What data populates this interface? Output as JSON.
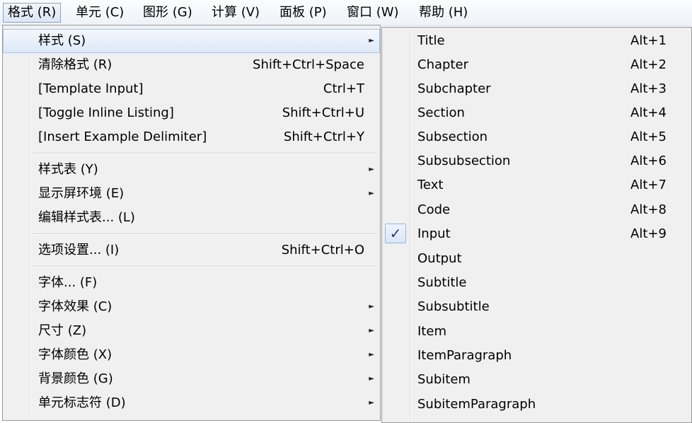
{
  "menubar": [
    {
      "label": "格式 (R)",
      "active": true
    },
    {
      "label": "单元 (C)"
    },
    {
      "label": "图形 (G)"
    },
    {
      "label": "计算 (V)"
    },
    {
      "label": "面板 (P)"
    },
    {
      "label": "窗口 (W)"
    },
    {
      "label": "帮助 (H)"
    }
  ],
  "format_menu": {
    "items": [
      {
        "label": "样式 (S)",
        "shortcut": "",
        "submenu": true,
        "highlighted": true
      },
      {
        "label": "清除格式 (R)",
        "shortcut": "Shift+Ctrl+Space"
      },
      {
        "label": "[Template Input]",
        "shortcut": "Ctrl+T"
      },
      {
        "label": "[Toggle Inline Listing]",
        "shortcut": "Shift+Ctrl+U"
      },
      {
        "label": "[Insert Example Delimiter]",
        "shortcut": "Shift+Ctrl+Y"
      },
      {
        "label": "样式表 (Y)",
        "shortcut": "",
        "submenu": true
      },
      {
        "label": "显示屏环境 (E)",
        "shortcut": "",
        "submenu": true
      },
      {
        "label": "编辑样式表... (L)",
        "shortcut": ""
      },
      {
        "label": "选项设置... (I)",
        "shortcut": "Shift+Ctrl+O"
      },
      {
        "label": "字体... (F)",
        "shortcut": ""
      },
      {
        "label": "字体效果 (C)",
        "shortcut": "",
        "submenu": true
      },
      {
        "label": "尺寸 (Z)",
        "shortcut": "",
        "submenu": true
      },
      {
        "label": "字体颜色 (X)",
        "shortcut": "",
        "submenu": true
      },
      {
        "label": "背景颜色 (G)",
        "shortcut": "",
        "submenu": true
      },
      {
        "label": "单元标志符 (D)",
        "shortcut": "",
        "submenu": true
      }
    ],
    "arrow_glyph": "►"
  },
  "style_submenu": {
    "check_glyph": "✓",
    "items": [
      {
        "label": "Title",
        "shortcut": "Alt+1"
      },
      {
        "label": "Chapter",
        "shortcut": "Alt+2"
      },
      {
        "label": "Subchapter",
        "shortcut": "Alt+3"
      },
      {
        "label": "Section",
        "shortcut": "Alt+4"
      },
      {
        "label": "Subsection",
        "shortcut": "Alt+5"
      },
      {
        "label": "Subsubsection",
        "shortcut": "Alt+6"
      },
      {
        "label": "Text",
        "shortcut": "Alt+7"
      },
      {
        "label": "Code",
        "shortcut": "Alt+8"
      },
      {
        "label": "Input",
        "shortcut": "Alt+9",
        "checked": true
      },
      {
        "label": "Output",
        "shortcut": ""
      },
      {
        "label": "Subtitle",
        "shortcut": ""
      },
      {
        "label": "Subsubtitle",
        "shortcut": ""
      },
      {
        "label": "Item",
        "shortcut": ""
      },
      {
        "label": "ItemParagraph",
        "shortcut": ""
      },
      {
        "label": "Subitem",
        "shortcut": ""
      },
      {
        "label": "SubitemParagraph",
        "shortcut": ""
      }
    ]
  }
}
